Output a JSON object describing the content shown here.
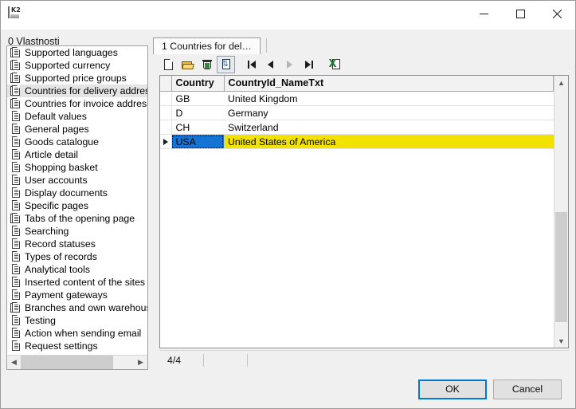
{
  "window": {
    "app_icon": "app-k2-icon",
    "minimize_label": "Minimize",
    "maximize_label": "Maximize",
    "close_label": "Close"
  },
  "left_pane": {
    "label_accesskey": "0",
    "label_text": " Vlastnosti",
    "items": [
      {
        "label": "Supported languages",
        "icon": "multi-page-icon",
        "selected": false
      },
      {
        "label": "Supported currency",
        "icon": "multi-page-icon",
        "selected": false
      },
      {
        "label": "Supported price groups",
        "icon": "multi-page-icon",
        "selected": false
      },
      {
        "label": "Countries for delivery addresses",
        "icon": "multi-page-icon",
        "selected": true
      },
      {
        "label": "Countries for invoice addresses",
        "icon": "multi-page-icon",
        "selected": false
      },
      {
        "label": "Default values",
        "icon": "page-icon",
        "selected": false
      },
      {
        "label": "General pages",
        "icon": "page-icon",
        "selected": false
      },
      {
        "label": "Goods catalogue",
        "icon": "page-icon",
        "selected": false
      },
      {
        "label": "Article detail",
        "icon": "page-icon",
        "selected": false
      },
      {
        "label": "Shopping basket",
        "icon": "page-icon",
        "selected": false
      },
      {
        "label": "User accounts",
        "icon": "page-icon",
        "selected": false
      },
      {
        "label": "Display documents",
        "icon": "page-icon",
        "selected": false
      },
      {
        "label": "Specific pages",
        "icon": "page-icon",
        "selected": false
      },
      {
        "label": "Tabs of the opening page",
        "icon": "multi-page-icon",
        "selected": false
      },
      {
        "label": "Searching",
        "icon": "page-icon",
        "selected": false
      },
      {
        "label": "Record statuses",
        "icon": "page-icon",
        "selected": false
      },
      {
        "label": "Types of records",
        "icon": "page-icon",
        "selected": false
      },
      {
        "label": "Analytical tools",
        "icon": "page-icon",
        "selected": false
      },
      {
        "label": "Inserted content of the sites",
        "icon": "page-icon",
        "selected": false
      },
      {
        "label": "Payment gateways",
        "icon": "page-icon",
        "selected": false
      },
      {
        "label": "Branches and own warehouses",
        "icon": "multi-page-icon",
        "selected": false
      },
      {
        "label": "Testing",
        "icon": "page-icon",
        "selected": false
      },
      {
        "label": "Action when sending email",
        "icon": "page-icon",
        "selected": false
      },
      {
        "label": "Request settings",
        "icon": "page-icon",
        "selected": false
      }
    ]
  },
  "right_pane": {
    "tab": {
      "label": "1 Countries for del…"
    },
    "toolbar": [
      {
        "name": "new-record-button",
        "icon": "new-document-icon",
        "enabled": true,
        "active": false
      },
      {
        "name": "open-record-button",
        "icon": "open-folder-icon",
        "enabled": true,
        "active": false
      },
      {
        "name": "delete-record-button",
        "icon": "trash-icon",
        "enabled": true,
        "active": false
      },
      {
        "name": "refresh-button",
        "icon": "refresh-document-icon",
        "enabled": true,
        "active": true
      },
      {
        "name": "first-record-button",
        "icon": "nav-first-icon",
        "enabled": true,
        "active": false
      },
      {
        "name": "previous-record-button",
        "icon": "nav-previous-icon",
        "enabled": true,
        "active": false
      },
      {
        "name": "next-record-button",
        "icon": "nav-next-icon",
        "enabled": false,
        "active": false
      },
      {
        "name": "last-record-button",
        "icon": "nav-last-icon",
        "enabled": true,
        "active": false
      },
      {
        "name": "export-excel-button",
        "icon": "excel-export-icon",
        "enabled": true,
        "active": false
      }
    ],
    "grid": {
      "columns": [
        "Country",
        "CountryId_NameTxt"
      ],
      "rows": [
        {
          "country": "GB",
          "name": "United Kingdom",
          "selected": false,
          "marker": false
        },
        {
          "country": "D",
          "name": "Germany",
          "selected": false,
          "marker": false
        },
        {
          "country": "CH",
          "name": "Switzerland",
          "selected": false,
          "marker": false
        },
        {
          "country": "USA",
          "name": "United States of America",
          "selected": true,
          "marker": true
        }
      ]
    },
    "status": {
      "record_position": "4/4",
      "cell_two": "",
      "cell_three": ""
    }
  },
  "footer": {
    "ok_label": "OK",
    "cancel_label": "Cancel"
  },
  "colors": {
    "selection_blue": "#1674d4",
    "row_highlight_yellow": "#f2e200",
    "default_button_border": "#0078d7",
    "window_background": "#f0f0f0"
  }
}
